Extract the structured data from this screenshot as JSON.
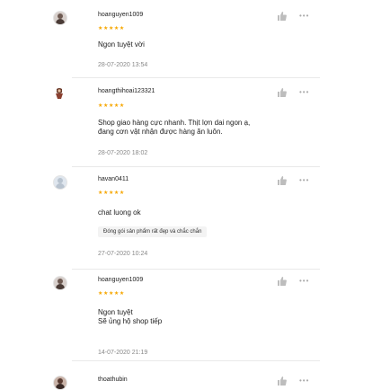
{
  "reviews": [
    {
      "username": "hoanguyen1009",
      "stars": "★★★★★",
      "comment": [
        "Ngon tuyệt vời"
      ],
      "tag": "",
      "time": "28-07-2020 13:54"
    },
    {
      "username": "hoangthihoai123321",
      "stars": "★★★★★",
      "comment": [
        "Shop giao hàng cực nhanh. Thịt lợn dai ngon ạ,",
        "đang cơn vật nhận được hàng ăn luôn."
      ],
      "tag": "",
      "time": "28-07-2020 18:02"
    },
    {
      "username": "havan0411",
      "stars": "★★★★★",
      "comment": [
        "chat luong ok"
      ],
      "tag": "Đóng gói sản phẩm rất đẹp và chắc chắn",
      "time": "27-07-2020 10:24"
    },
    {
      "username": "hoanguyen1009",
      "stars": "★★★★★",
      "comment": [
        "Ngon tuyệt",
        "Sẽ ủng hộ shop tiếp"
      ],
      "tag": "",
      "time": "14-07-2020 21:19"
    },
    {
      "username": "thoathubin",
      "stars": "",
      "comment": [],
      "tag": "",
      "time": ""
    }
  ],
  "icons": {
    "like": "thumbs-up-icon",
    "more": "more-horizontal-icon"
  },
  "colors": {
    "star": "#f6a700",
    "muted": "#888888"
  }
}
